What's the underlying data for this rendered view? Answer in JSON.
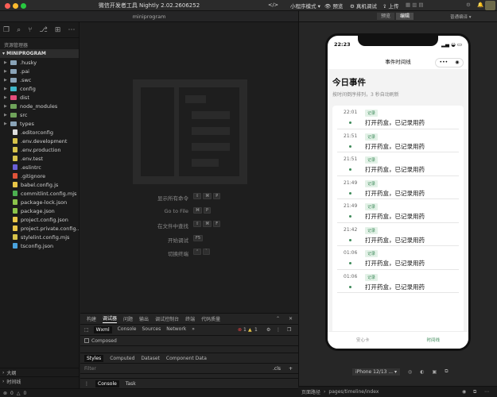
{
  "window": {
    "title": "微信开发者工具 Nightly 2.02.2606252",
    "project": "miniprogram",
    "mode": "小程序模式",
    "actions": [
      "预览",
      "真机调试",
      "上传"
    ]
  },
  "simulator_toolbar": {
    "tabs": [
      "预览",
      "编辑"
    ],
    "compile_mode": "普通编译"
  },
  "sidebar": {
    "title": "资源管理器",
    "project_header": "MINIPROGRAM",
    "items": [
      {
        "label": ".husky",
        "type": "folder",
        "color": "#8aa4b8"
      },
      {
        "label": ".pai",
        "type": "folder",
        "color": "#8aa4b8"
      },
      {
        "label": ".swc",
        "type": "folder",
        "color": "#8aa4b8"
      },
      {
        "label": "config",
        "type": "folder",
        "color": "#3fb6c9"
      },
      {
        "label": "dist",
        "type": "folder",
        "color": "#e44d7b"
      },
      {
        "label": "node_modules",
        "type": "folder",
        "color": "#6fa35a"
      },
      {
        "label": "src",
        "type": "folder",
        "color": "#6fa35a"
      },
      {
        "label": "types",
        "type": "folder",
        "color": "#8aa4b8"
      },
      {
        "label": ".editorconfig",
        "type": "file",
        "color": "#dddddd"
      },
      {
        "label": ".env.development",
        "type": "file",
        "color": "#d6c24a"
      },
      {
        "label": ".env.production",
        "type": "file",
        "color": "#d6c24a"
      },
      {
        "label": ".env.test",
        "type": "file",
        "color": "#d6c24a"
      },
      {
        "label": ".eslintrc",
        "type": "file",
        "color": "#6a5fd6"
      },
      {
        "label": ".gitignore",
        "type": "file",
        "color": "#e0533a"
      },
      {
        "label": "babel.config.js",
        "type": "file",
        "color": "#e8c547"
      },
      {
        "label": "commitlint.config.mjs",
        "type": "file",
        "color": "#4caf50"
      },
      {
        "label": "package-lock.json",
        "type": "file",
        "color": "#8bc34a"
      },
      {
        "label": "package.json",
        "type": "file",
        "color": "#8bc34a"
      },
      {
        "label": "project.config.json",
        "type": "file",
        "color": "#e8c547"
      },
      {
        "label": "project.private.config...",
        "type": "file",
        "color": "#e8c547"
      },
      {
        "label": "stylelint.config.mjs",
        "type": "file",
        "color": "#d6c24a"
      },
      {
        "label": "tsconfig.json",
        "type": "file",
        "color": "#4aa3df"
      }
    ],
    "outline_label": "大纲",
    "timeline_label": "时间线"
  },
  "editor_commands": [
    {
      "label": "显示所有命令",
      "keys": [
        "⇧",
        "⌘",
        "P"
      ]
    },
    {
      "label": "Go to File",
      "keys": [
        "⌘",
        "P"
      ]
    },
    {
      "label": "在文件中查找",
      "keys": [
        "⇧",
        "⌘",
        "F"
      ]
    },
    {
      "label": "开始调试",
      "keys": [
        "F5"
      ]
    },
    {
      "label": "切换终端",
      "keys": [
        "⌃",
        "`"
      ]
    }
  ],
  "devtools": {
    "panel_tabs": [
      "构建",
      "调试器",
      "问题",
      "输出",
      "调试控制台",
      "终端",
      "代码质量"
    ],
    "tool_tabs": [
      "Wxml",
      "Console",
      "Sources",
      "Network",
      "»"
    ],
    "errors": "1",
    "warnings": "1",
    "composed_label": "Composed",
    "sub_tabs": [
      "Styles",
      "Computed",
      "Dataset",
      "Component Data"
    ],
    "filter_placeholder": "Filter",
    "cls_label": ".cls",
    "console_tabs": [
      "Console",
      "Task"
    ]
  },
  "status_left": {
    "errors": "0",
    "warnings": "0"
  },
  "status_right": {
    "path_label": "页面路径",
    "path": "pages/timeline/index"
  },
  "phone": {
    "time": "22:23",
    "nav_title": "事件时间线",
    "page_title": "今日事件",
    "page_subtitle": "按时间倒序排列，3 秒自动刷新",
    "events": [
      {
        "time": "22:01",
        "tag": "记录",
        "text": "打开药盒，已记录用药"
      },
      {
        "time": "21:51",
        "tag": "记录",
        "text": "打开药盒，已记录用药"
      },
      {
        "time": "21:51",
        "tag": "记录",
        "text": "打开药盒，已记录用药"
      },
      {
        "time": "21:49",
        "tag": "记录",
        "text": "打开药盒，已记录用药"
      },
      {
        "time": "21:49",
        "tag": "记录",
        "text": "打开药盒，已记录用药"
      },
      {
        "time": "21:42",
        "tag": "记录",
        "text": "打开药盒，已记录用药"
      },
      {
        "time": "01:06",
        "tag": "记录",
        "text": "打开药盒，已记录用药"
      },
      {
        "time": "01:06",
        "tag": "记录",
        "text": "打开药盒，已记录用药"
      }
    ],
    "tabs": [
      "安心卡",
      "时间线"
    ],
    "device": "iPhone 12/13 ..."
  },
  "colors": {
    "accent_green": "#3e8a5a",
    "tab_active": "#3e8a5a"
  }
}
